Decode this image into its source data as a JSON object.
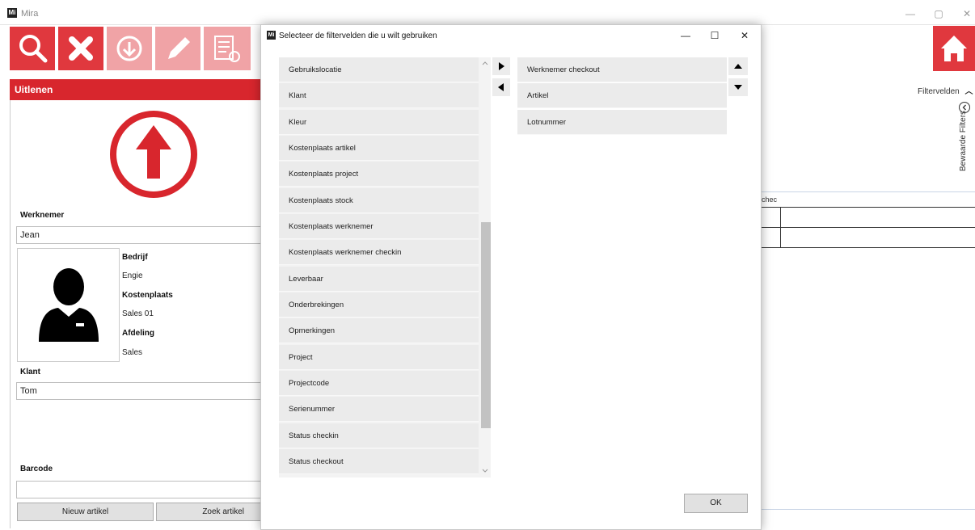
{
  "window": {
    "title": "Mira",
    "logo_text": "Mi",
    "minimize": "—",
    "maximize": "▢",
    "close": "✕"
  },
  "toolbar": {
    "buttons": [
      {
        "icon": "search-icon"
      },
      {
        "icon": "close-icon"
      },
      {
        "icon": "download-icon"
      },
      {
        "icon": "pencil-icon"
      },
      {
        "icon": "settings-list-icon"
      }
    ],
    "home_icon": "home-icon",
    "accent": "#e0383e",
    "accent_dim": "#f0a3a6"
  },
  "left_panel": {
    "header": "Uitlenen",
    "big_icon": "arrow-up-circle-icon",
    "werknemer_label": "Werknemer",
    "werknemer_value": "Jean",
    "avatar_icon": "person-icon",
    "bedrijf_label": "Bedrijf",
    "bedrijf_value": "Engie",
    "kostenplaats_label": "Kostenplaats",
    "kostenplaats_value": "Sales 01",
    "afdeling_label": "Afdeling",
    "afdeling_value": "Sales",
    "klant_label": "Klant",
    "klant_value": "Tom",
    "barcode_label": "Barcode",
    "barcode_value": "",
    "nieuw_artikel": "Nieuw artikel",
    "zoek_artikel": "Zoek artikel"
  },
  "right_panel": {
    "filtervelden": "Filtervelden",
    "bewaarde_filters": "Bewaarde Filters",
    "grid_header_fragment": "chec"
  },
  "dialog": {
    "logo_text": "Mi",
    "title": "Selecteer de filtervelden die u wilt gebruiken",
    "minimize": "—",
    "maximize": "☐",
    "close": "✕",
    "available_fields": [
      "Gebruikslocatie",
      "Klant",
      "Kleur",
      "Kostenplaats artikel",
      "Kostenplaats project",
      "Kostenplaats stock",
      "Kostenplaats werknemer",
      "Kostenplaats werknemer checkin",
      "Leverbaar",
      "Onderbrekingen",
      "Opmerkingen",
      "Project",
      "Projectcode",
      "Serienummer",
      "Status checkin",
      "Status checkout"
    ],
    "selected_fields": [
      "Werknemer checkout",
      "Artikel",
      "Lotnummer"
    ],
    "ok": "OK"
  }
}
